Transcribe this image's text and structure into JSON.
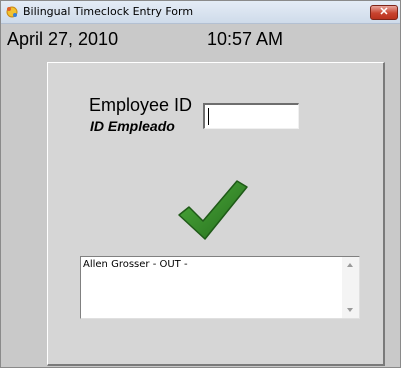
{
  "window": {
    "title": "Bilingual Timeclock Entry Form",
    "close_label": "✕"
  },
  "header": {
    "date": "April 27, 2010",
    "time": "10:57 AM"
  },
  "form": {
    "employee_id_label": "Employee ID",
    "employee_id_label_es": "ID Empleado",
    "employee_id_value": ""
  },
  "status": {
    "icon": "checkmark-icon",
    "icon_color": "#3a8f2e"
  },
  "log": {
    "text": "Allen Grosser - OUT -"
  }
}
